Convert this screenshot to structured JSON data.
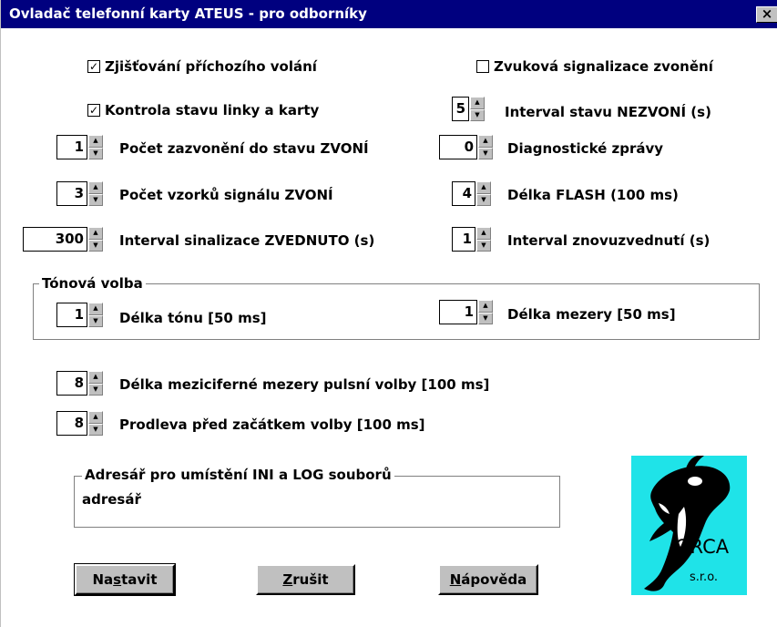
{
  "window": {
    "title": "Ovladač telefonní karty ATEUS - pro odborníky",
    "close_label": "×"
  },
  "checkboxes": {
    "incoming_call": {
      "label": "Zjišťování příchozího volání",
      "checked": true,
      "mark": "✓"
    },
    "sound_signal": {
      "label": "Zvuková signalizace zvonění",
      "checked": false,
      "mark": ""
    },
    "line_check": {
      "label": "Kontrola stavu linky a karty",
      "checked": true,
      "mark": "✓"
    }
  },
  "spinners": {
    "rings_count": {
      "value": "1",
      "label": "Počet zazvonění do stavu ZVONÍ"
    },
    "ring_samples": {
      "value": "3",
      "label": "Počet vzorků signálu ZVONÍ"
    },
    "pickup_interval": {
      "value": "300",
      "label": "Interval sinalizace ZVEDNUTO (s)"
    },
    "noring_interval": {
      "value": "5",
      "label": "Interval  stavu NEZVONÍ (s)"
    },
    "diag_messages": {
      "value": "0",
      "label": "Diagnostické zprávy"
    },
    "flash_length": {
      "value": "4",
      "label": "Délka FLASH (100 ms)"
    },
    "repickup_interval": {
      "value": "1",
      "label": "Interval znovuzvednutí (s)"
    },
    "tone_length": {
      "value": "1",
      "label": "Délka tónu [50 ms]"
    },
    "gap_length": {
      "value": "1",
      "label": "Délka mezery [50 ms]"
    },
    "interdigit_gap": {
      "value": "8",
      "label": "Délka meziciferné mezery pulsní volby [100 ms]"
    },
    "predial_delay": {
      "value": "8",
      "label": "Prodleva před začátkem volby [100 ms]"
    }
  },
  "tone_group": {
    "legend": "Tónová volba"
  },
  "directory_group": {
    "legend": "Adresář pro umístění INI a LOG souborů",
    "value": "adresář"
  },
  "buttons": {
    "set": {
      "pre": "Na",
      "key": "s",
      "post": "tavit"
    },
    "cancel": {
      "pre": "",
      "key": "Z",
      "post": "rušit"
    },
    "help": {
      "pre": "",
      "key": "N",
      "post": "ápověda"
    }
  },
  "logo": {
    "line1": "ORCA",
    "line2": "s.r.o.",
    "colors": {
      "background": "#1fe3e8",
      "orca": "#000000"
    }
  },
  "colors": {
    "titlebar": "#00007f",
    "button_face": "#c0c0c0"
  }
}
